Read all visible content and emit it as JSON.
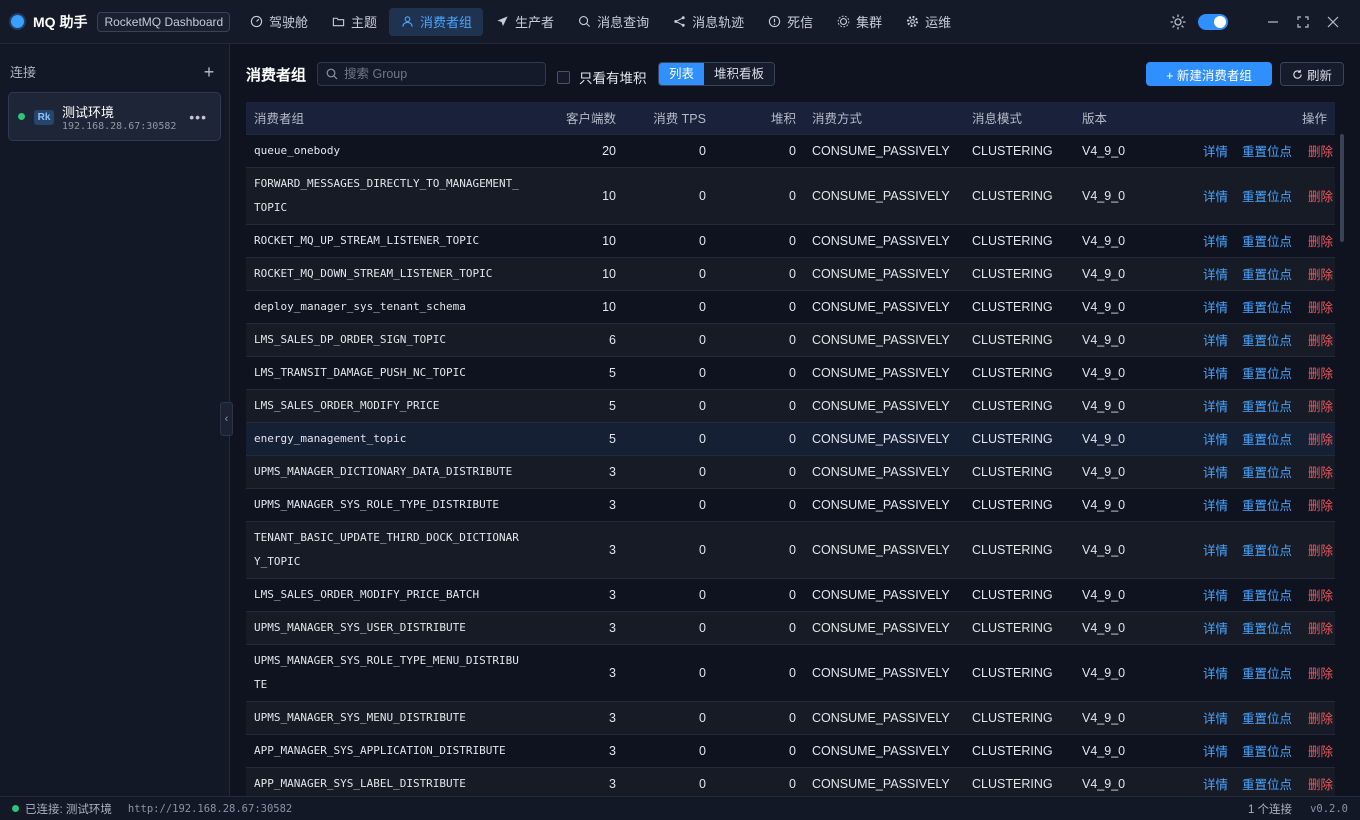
{
  "app": {
    "title": "MQ 助手",
    "tag": "RocketMQ Dashboard",
    "brand_color": "#3aa0ff"
  },
  "nav": [
    {
      "label": "驾驶舱",
      "icon": "gauge-icon"
    },
    {
      "label": "主题",
      "icon": "folder-icon"
    },
    {
      "label": "消费者组",
      "icon": "user-icon",
      "active": true
    },
    {
      "label": "生产者",
      "icon": "send-icon"
    },
    {
      "label": "消息查询",
      "icon": "search-icon"
    },
    {
      "label": "消息轨迹",
      "icon": "share-icon"
    },
    {
      "label": "死信",
      "icon": "alert-icon"
    },
    {
      "label": "集群",
      "icon": "cluster-icon"
    },
    {
      "label": "运维",
      "icon": "gear-icon"
    }
  ],
  "sidebar": {
    "header": "连接",
    "connection": {
      "badge": "Rk",
      "name": "测试环境",
      "address": "192.168.28.67:30582",
      "status_color": "#2fc27a"
    }
  },
  "toolbar": {
    "title": "消费者组",
    "search_placeholder": "搜索 Group",
    "only_backlog_label": "只看有堆积",
    "view_list": "列表",
    "view_board": "堆积看板",
    "new_button": "+ 新建消费者组",
    "refresh_button": "刷新"
  },
  "table": {
    "headers": {
      "group": "消费者组",
      "clients": "客户端数",
      "tps": "消费 TPS",
      "backlog": "堆积",
      "consume_type": "消费方式",
      "message_model": "消息模式",
      "version": "版本",
      "ops": "操作"
    },
    "op_labels": {
      "detail": "详情",
      "reset": "重置位点",
      "delete": "删除"
    },
    "rows": [
      {
        "group": "queue_onebody",
        "clients": "20",
        "tps": "0",
        "backlog": "0",
        "consume_type": "CONSUME_PASSIVELY",
        "message_model": "CLUSTERING",
        "version": "V4_9_0"
      },
      {
        "group": "FORWARD_MESSAGES_DIRECTLY_TO_MANAGEMENT_TOPIC",
        "clients": "10",
        "tps": "0",
        "backlog": "0",
        "consume_type": "CONSUME_PASSIVELY",
        "message_model": "CLUSTERING",
        "version": "V4_9_0"
      },
      {
        "group": "ROCKET_MQ_UP_STREAM_LISTENER_TOPIC",
        "clients": "10",
        "tps": "0",
        "backlog": "0",
        "consume_type": "CONSUME_PASSIVELY",
        "message_model": "CLUSTERING",
        "version": "V4_9_0"
      },
      {
        "group": "ROCKET_MQ_DOWN_STREAM_LISTENER_TOPIC",
        "clients": "10",
        "tps": "0",
        "backlog": "0",
        "consume_type": "CONSUME_PASSIVELY",
        "message_model": "CLUSTERING",
        "version": "V4_9_0"
      },
      {
        "group": "deploy_manager_sys_tenant_schema",
        "clients": "10",
        "tps": "0",
        "backlog": "0",
        "consume_type": "CONSUME_PASSIVELY",
        "message_model": "CLUSTERING",
        "version": "V4_9_0"
      },
      {
        "group": "LMS_SALES_DP_ORDER_SIGN_TOPIC",
        "clients": "6",
        "tps": "0",
        "backlog": "0",
        "consume_type": "CONSUME_PASSIVELY",
        "message_model": "CLUSTERING",
        "version": "V4_9_0"
      },
      {
        "group": "LMS_TRANSIT_DAMAGE_PUSH_NC_TOPIC",
        "clients": "5",
        "tps": "0",
        "backlog": "0",
        "consume_type": "CONSUME_PASSIVELY",
        "message_model": "CLUSTERING",
        "version": "V4_9_0"
      },
      {
        "group": "LMS_SALES_ORDER_MODIFY_PRICE",
        "clients": "5",
        "tps": "0",
        "backlog": "0",
        "consume_type": "CONSUME_PASSIVELY",
        "message_model": "CLUSTERING",
        "version": "V4_9_0"
      },
      {
        "group": "energy_management_topic",
        "clients": "5",
        "tps": "0",
        "backlog": "0",
        "consume_type": "CONSUME_PASSIVELY",
        "message_model": "CLUSTERING",
        "version": "V4_9_0"
      },
      {
        "group": "UPMS_MANAGER_DICTIONARY_DATA_DISTRIBUTE",
        "clients": "3",
        "tps": "0",
        "backlog": "0",
        "consume_type": "CONSUME_PASSIVELY",
        "message_model": "CLUSTERING",
        "version": "V4_9_0"
      },
      {
        "group": "UPMS_MANAGER_SYS_ROLE_TYPE_DISTRIBUTE",
        "clients": "3",
        "tps": "0",
        "backlog": "0",
        "consume_type": "CONSUME_PASSIVELY",
        "message_model": "CLUSTERING",
        "version": "V4_9_0"
      },
      {
        "group": "TENANT_BASIC_UPDATE_THIRD_DOCK_DICTIONARY_TOPIC",
        "clients": "3",
        "tps": "0",
        "backlog": "0",
        "consume_type": "CONSUME_PASSIVELY",
        "message_model": "CLUSTERING",
        "version": "V4_9_0"
      },
      {
        "group": "LMS_SALES_ORDER_MODIFY_PRICE_BATCH",
        "clients": "3",
        "tps": "0",
        "backlog": "0",
        "consume_type": "CONSUME_PASSIVELY",
        "message_model": "CLUSTERING",
        "version": "V4_9_0"
      },
      {
        "group": "UPMS_MANAGER_SYS_USER_DISTRIBUTE",
        "clients": "3",
        "tps": "0",
        "backlog": "0",
        "consume_type": "CONSUME_PASSIVELY",
        "message_model": "CLUSTERING",
        "version": "V4_9_0"
      },
      {
        "group": "UPMS_MANAGER_SYS_ROLE_TYPE_MENU_DISTRIBUTE",
        "clients": "3",
        "tps": "0",
        "backlog": "0",
        "consume_type": "CONSUME_PASSIVELY",
        "message_model": "CLUSTERING",
        "version": "V4_9_0"
      },
      {
        "group": "UPMS_MANAGER_SYS_MENU_DISTRIBUTE",
        "clients": "3",
        "tps": "0",
        "backlog": "0",
        "consume_type": "CONSUME_PASSIVELY",
        "message_model": "CLUSTERING",
        "version": "V4_9_0"
      },
      {
        "group": "APP_MANAGER_SYS_APPLICATION_DISTRIBUTE",
        "clients": "3",
        "tps": "0",
        "backlog": "0",
        "consume_type": "CONSUME_PASSIVELY",
        "message_model": "CLUSTERING",
        "version": "V4_9_0"
      },
      {
        "group": "APP_MANAGER_SYS_LABEL_DISTRIBUTE",
        "clients": "3",
        "tps": "0",
        "backlog": "0",
        "consume_type": "CONSUME_PASSIVELY",
        "message_model": "CLUSTERING",
        "version": "V4_9_0"
      }
    ]
  },
  "status": {
    "connected_label": "已连接: 测试环境",
    "url": "http://192.168.28.67:30582",
    "connections": "1 个连接",
    "version": "v0.2.0"
  },
  "colors": {
    "accent": "#2f8fff",
    "link": "#4aa4ff",
    "danger": "#f0575a",
    "online": "#2fc27a"
  }
}
